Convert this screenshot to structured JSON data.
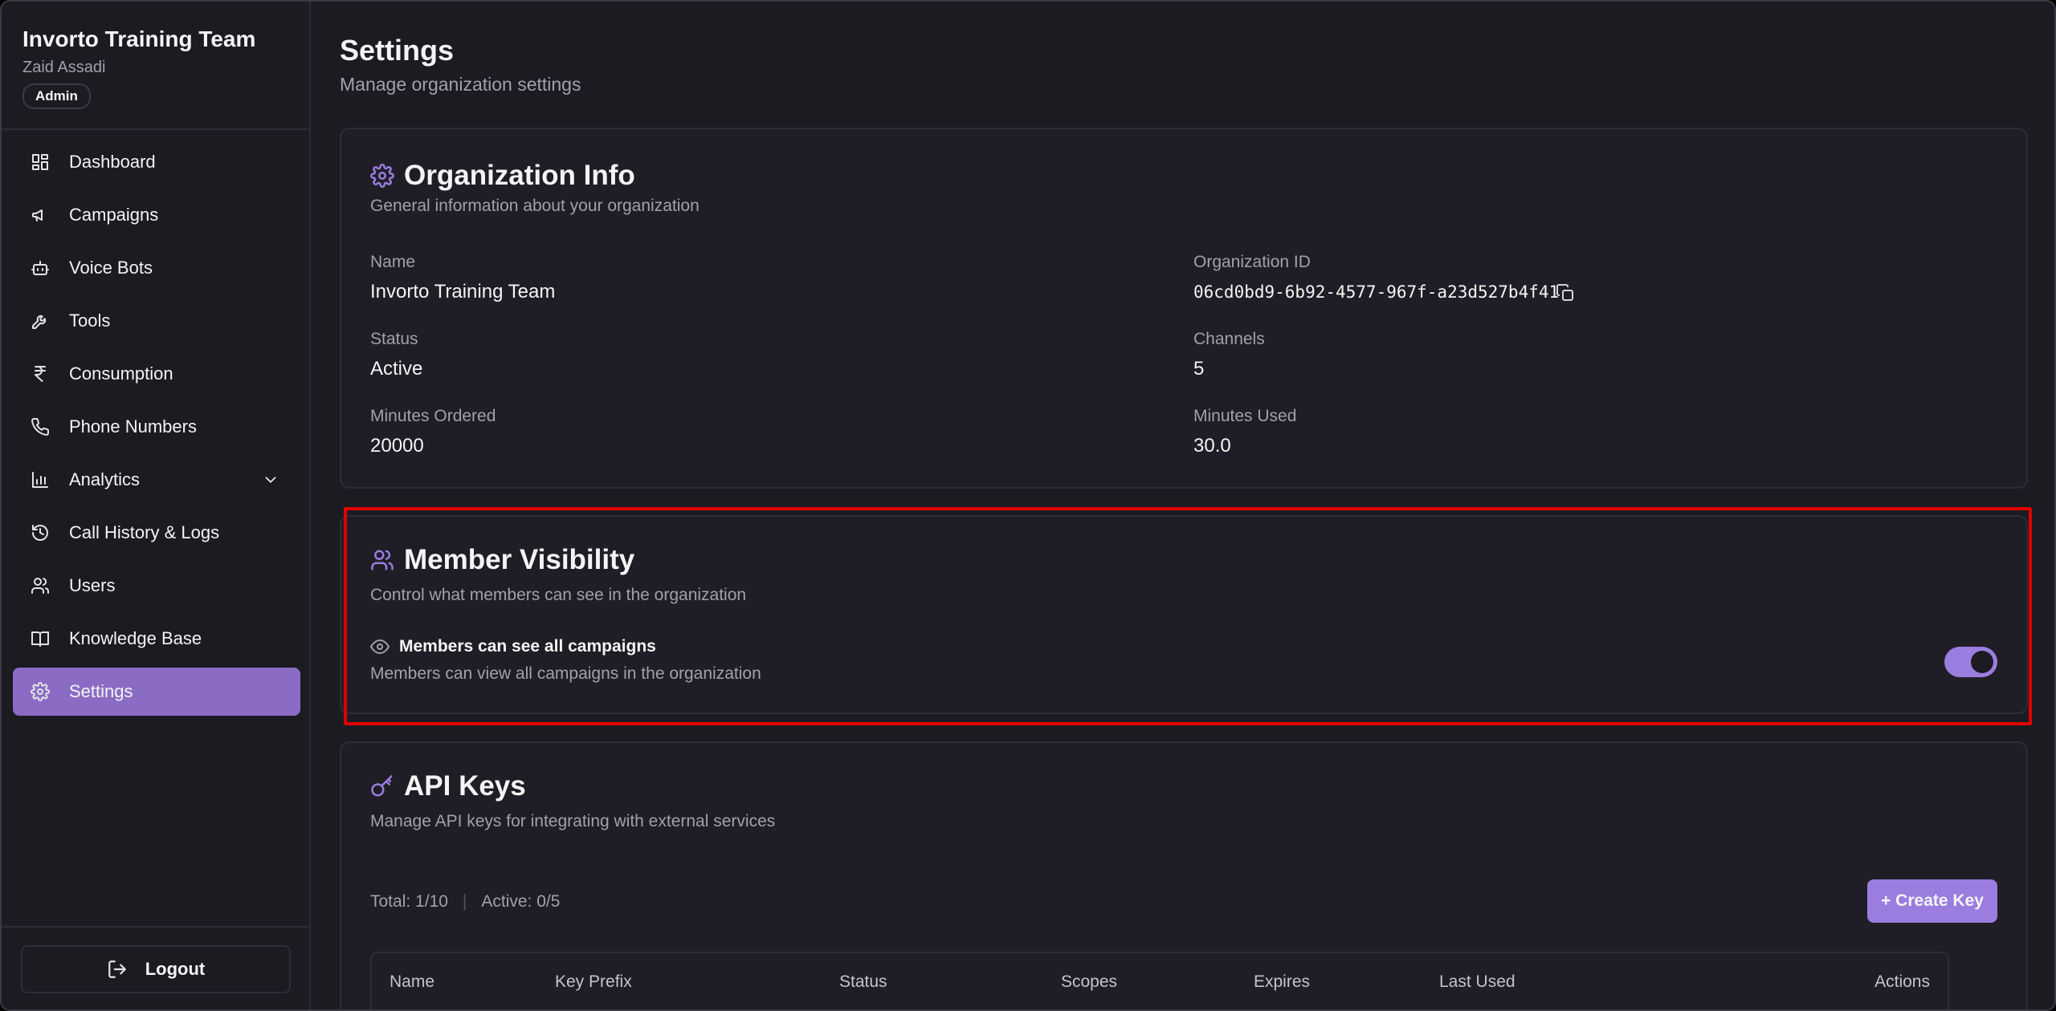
{
  "sidebar": {
    "org_name": "Invorto Training Team",
    "user_name": "Zaid Assadi",
    "role": "Admin",
    "items": [
      {
        "label": "Dashboard",
        "icon": "dashboard-icon"
      },
      {
        "label": "Campaigns",
        "icon": "megaphone-icon"
      },
      {
        "label": "Voice Bots",
        "icon": "bot-icon"
      },
      {
        "label": "Tools",
        "icon": "wrench-icon"
      },
      {
        "label": "Consumption",
        "icon": "rupee-icon"
      },
      {
        "label": "Phone Numbers",
        "icon": "phone-icon"
      },
      {
        "label": "Analytics",
        "icon": "bar-chart-icon"
      },
      {
        "label": "Call History & Logs",
        "icon": "history-icon"
      },
      {
        "label": "Users",
        "icon": "users-icon"
      },
      {
        "label": "Knowledge Base",
        "icon": "book-icon"
      },
      {
        "label": "Settings",
        "icon": "gear-icon"
      }
    ],
    "active": "Settings",
    "logout_label": "Logout"
  },
  "page": {
    "title": "Settings",
    "subtitle": "Manage organization settings"
  },
  "org_info": {
    "title": "Organization Info",
    "subtitle": "General information about your organization",
    "fields": {
      "name_label": "Name",
      "name_value": "Invorto Training Team",
      "org_id_label": "Organization ID",
      "org_id_value": "06cd0bd9-6b92-4577-967f-a23d527b4f41",
      "status_label": "Status",
      "status_value": "Active",
      "channels_label": "Channels",
      "channels_value": "5",
      "minutes_ordered_label": "Minutes Ordered",
      "minutes_ordered_value": "20000",
      "minutes_used_label": "Minutes Used",
      "minutes_used_value": "30.0"
    }
  },
  "member_visibility": {
    "title": "Member Visibility",
    "subtitle": "Control what members can see in the organization",
    "setting_label": "Members can see all campaigns",
    "setting_desc": "Members can view all campaigns in the organization",
    "enabled": true
  },
  "api_keys": {
    "title": "API Keys",
    "subtitle": "Manage API keys for integrating with external services",
    "total": "Total: 1/10",
    "separator": "|",
    "active": "Active: 0/5",
    "create_label": "+ Create Key",
    "columns": [
      "Name",
      "Key Prefix",
      "Status",
      "Scopes",
      "Expires",
      "Last Used",
      "Actions"
    ]
  },
  "colors": {
    "accent": "#9b7de0",
    "active_nav": "#8b6cc4",
    "highlight": "#e00000",
    "background": "#1c1b22"
  }
}
